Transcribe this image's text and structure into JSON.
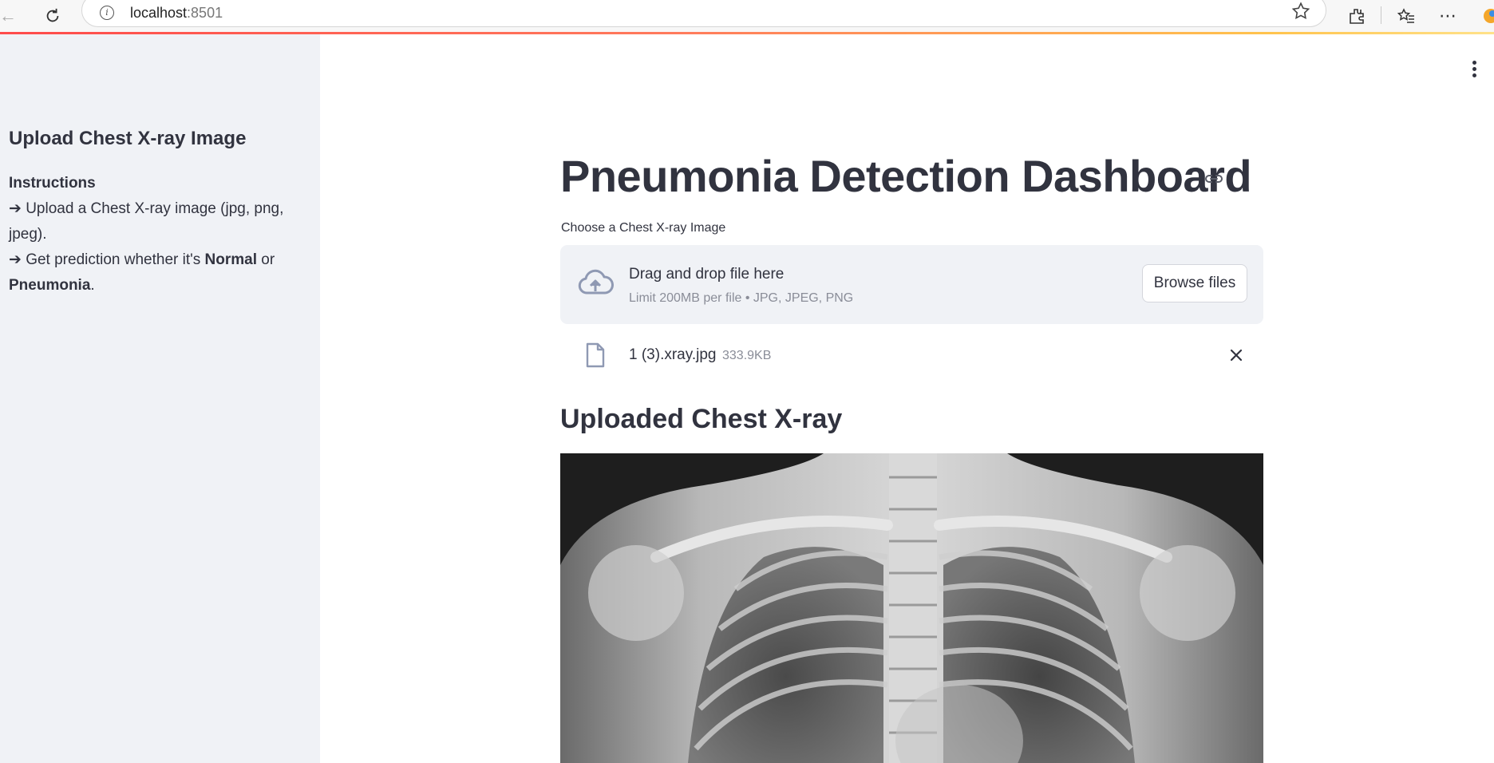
{
  "browser": {
    "url_host": "localhost",
    "url_port": ":8501"
  },
  "sidebar": {
    "title": "Upload Chest X-ray Image",
    "instructions_heading": "Instructions",
    "line1": "➔ Upload a Chest X-ray image (jpg, png, jpeg).",
    "line2_prefix": "➔ Get prediction whether it's ",
    "line2_normal": "Normal",
    "line2_or": " or ",
    "line2_pneumonia": "Pneumonia",
    "line2_end": "."
  },
  "main": {
    "title": "Pneumonia Detection Dashboard",
    "uploader_label": "Choose a Chest X-ray Image",
    "dropzone_title": "Drag and drop file here",
    "dropzone_limit": "Limit 200MB per file • JPG, JPEG, PNG",
    "browse_label": "Browse files",
    "file_name": "1 (3).xray.jpg",
    "file_size": "333.9KB",
    "image_section_title": "Uploaded Chest X-ray"
  },
  "colors": {
    "sidebar_bg": "#f0f2f6",
    "text": "#31333f",
    "accent": "#ff4b4b"
  }
}
